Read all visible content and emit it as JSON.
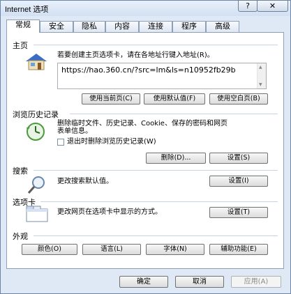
{
  "window": {
    "title": "Internet 选项",
    "help": "?",
    "close": "✕"
  },
  "tabs": [
    "常规",
    "安全",
    "隐私",
    "内容",
    "连接",
    "程序",
    "高级"
  ],
  "home": {
    "section": "主页",
    "instruction": "若要创建主页选项卡，请在各地址行键入地址(R)。",
    "url": "https://hao.360.cn/?src=lm&ls=n10952fb29b",
    "buttons": [
      "使用当前页(C)",
      "使用默认值(F)",
      "使用空白页(B)"
    ]
  },
  "history": {
    "section": "浏览历史记录",
    "text_line1": "删除临时文件、历史记录、Cookie、保存的密码和网页",
    "text_line2": "表单信息。",
    "checkbox_label": "退出时删除浏览历史记录(W)",
    "delete_button": "删除(D)...",
    "settings_button": "设置(S)"
  },
  "search": {
    "section": "搜索",
    "text": "更改搜索默认值。",
    "settings_button": "设置(I)"
  },
  "tabs_section": {
    "section": "选项卡",
    "text": "更改网页在选项卡中显示的方式。",
    "settings_button": "设置(T)"
  },
  "appearance": {
    "section": "外观",
    "buttons": [
      "颜色(O)",
      "语言(L)",
      "字体(N)",
      "辅助功能(E)"
    ]
  },
  "footer": {
    "ok": "确定",
    "cancel": "取消",
    "apply": "应用(A)"
  }
}
